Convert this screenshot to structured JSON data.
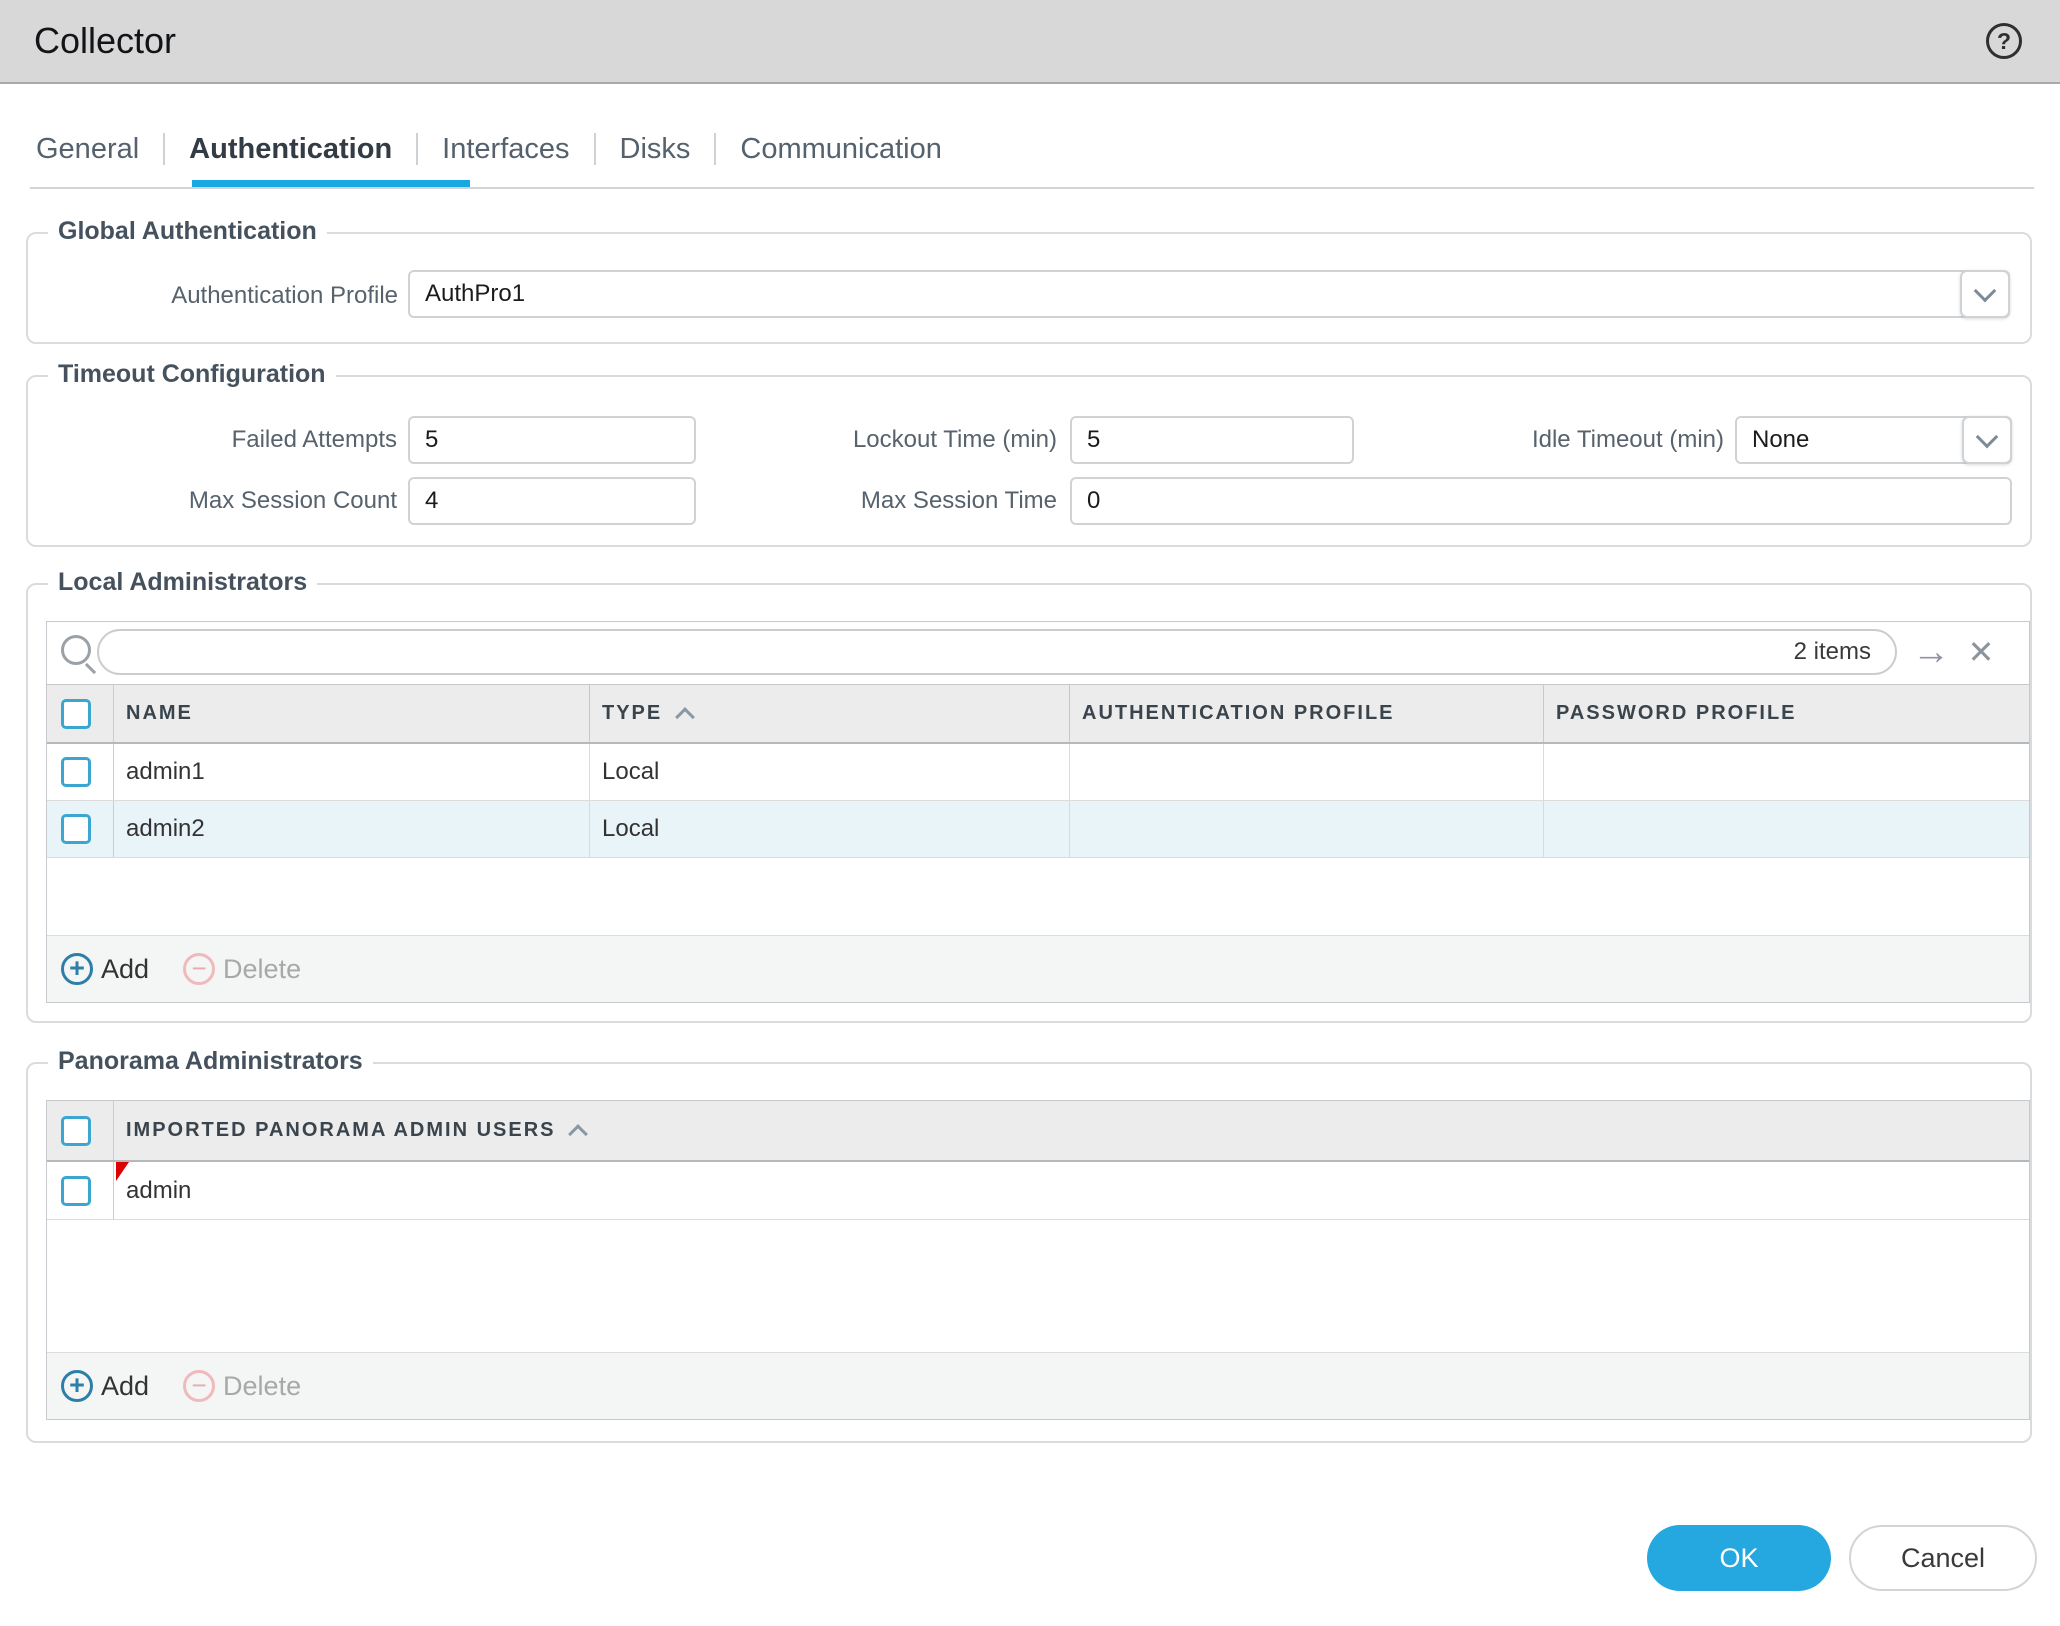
{
  "window": {
    "title": "Collector"
  },
  "tabs": [
    {
      "label": "General"
    },
    {
      "label": "Authentication"
    },
    {
      "label": "Interfaces"
    },
    {
      "label": "Disks"
    },
    {
      "label": "Communication"
    }
  ],
  "active_tab": "Authentication",
  "global_auth": {
    "legend": "Global Authentication",
    "auth_profile": {
      "label": "Authentication Profile",
      "value": "AuthPro1"
    }
  },
  "timeout": {
    "legend": "Timeout Configuration",
    "failed_attempts": {
      "label": "Failed Attempts",
      "value": "5"
    },
    "lockout_time": {
      "label": "Lockout Time (min)",
      "value": "5"
    },
    "idle_timeout": {
      "label": "Idle Timeout (min)",
      "value": "None"
    },
    "max_session_count": {
      "label": "Max Session Count",
      "value": "4"
    },
    "max_session_time": {
      "label": "Max Session Time",
      "value": "0"
    }
  },
  "local_admins": {
    "legend": "Local Administrators",
    "search": {
      "value": "",
      "count": "2 items"
    },
    "columns": {
      "name": "NAME",
      "type": "TYPE",
      "auth_profile": "AUTHENTICATION PROFILE",
      "password_profile": "PASSWORD PROFILE"
    },
    "sorted_column": "TYPE",
    "sort_direction": "asc",
    "rows": [
      {
        "name": "admin1",
        "type": "Local",
        "auth_profile": "",
        "password_profile": ""
      },
      {
        "name": "admin2",
        "type": "Local",
        "auth_profile": "",
        "password_profile": ""
      }
    ],
    "add_label": "Add",
    "delete_label": "Delete"
  },
  "panorama_admins": {
    "legend": "Panorama Administrators",
    "column": "IMPORTED PANORAMA ADMIN USERS",
    "sort_direction": "asc",
    "rows": [
      {
        "name": "admin",
        "modified": true
      }
    ],
    "add_label": "Add",
    "delete_label": "Delete"
  },
  "footer": {
    "ok": "OK",
    "cancel": "Cancel"
  },
  "colors": {
    "accent": "#18a8e2",
    "ok_button": "#25a8e0",
    "header_bg": "#d8d8d8",
    "row_alt": "#e9f4f9",
    "add_icon": "#2d7fa9",
    "delete_icon": "#e9a9ae",
    "modified_flag": "#dd0000",
    "checkbox_border": "#3ba6d2"
  }
}
